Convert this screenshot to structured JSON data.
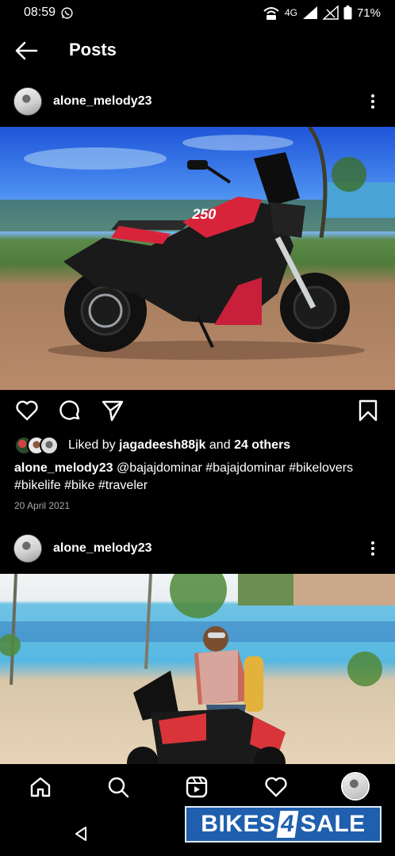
{
  "status_bar": {
    "time": "08:59",
    "network": "4G",
    "battery": "71%"
  },
  "header": {
    "title": "Posts"
  },
  "posts": [
    {
      "username": "alone_melody23",
      "liked_by_user": "jagadeesh88jk",
      "liked_others": "24 others",
      "caption_user": "alone_melody23",
      "caption_text": "@bajajdominar #bajajdominar #bikelovers #bikelife #bike #traveler",
      "date": "20 April 2021",
      "image_text": "250"
    },
    {
      "username": "alone_melody23"
    }
  ],
  "labels": {
    "liked_by": "Liked by",
    "and": "and"
  },
  "watermark": {
    "part1": "BIKES",
    "part2": "4",
    "part3": "SALE"
  },
  "icons": [
    "back-arrow-icon",
    "more-icon",
    "heart-icon",
    "comment-icon",
    "share-icon",
    "bookmark-icon",
    "home-icon",
    "search-icon",
    "reels-icon",
    "activity-icon",
    "profile-avatar",
    "system-back-icon"
  ]
}
